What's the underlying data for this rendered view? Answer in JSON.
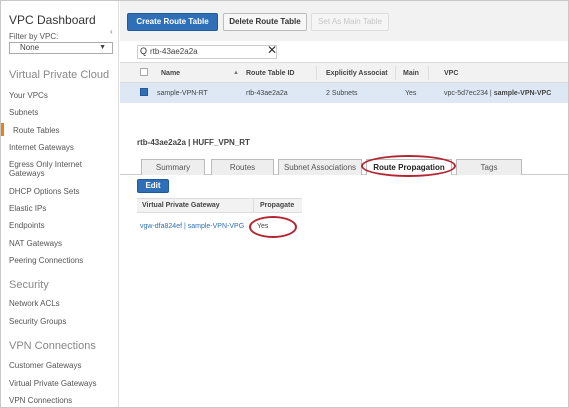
{
  "sidebar": {
    "title": "VPC Dashboard",
    "collapse_glyph": "‹",
    "filter_label": "Filter by VPC:",
    "filter_value": "None",
    "sections": {
      "vpc": "Virtual Private Cloud",
      "security": "Security",
      "vpn": "VPN Connections"
    },
    "vpc_items": [
      "Your VPCs",
      "Subnets",
      "Route Tables",
      "Internet Gateways",
      "Egress Only Internet",
      "Gateways",
      "DHCP Options Sets",
      "Elastic IPs",
      "Endpoints",
      "NAT Gateways",
      "Peering Connections"
    ],
    "security_items": [
      "Network ACLs",
      "Security Groups"
    ],
    "vpn_items": [
      "Customer Gateways",
      "Virtual Private Gateways",
      "VPN Connections"
    ]
  },
  "toolbar": {
    "create": "Create Route Table",
    "delete": "Delete Route Table",
    "set_main": "Set As Main Table"
  },
  "search": {
    "value": "rtb-43ae2a2a",
    "search_glyph": "Q",
    "clear_glyph": "✕"
  },
  "table": {
    "headers": {
      "name": "Name",
      "route_table_id": "Route Table ID",
      "explicit": "Explicitly Associat",
      "main": "Main",
      "vpc": "VPC"
    },
    "sort_glyph": "▲",
    "row": {
      "name": "sample-VPN-RT",
      "route_table_id": "rtb-43ae2a2a",
      "explicit": "2 Subnets",
      "main": "Yes",
      "vpc_id": "vpc-5d7ec234 |",
      "vpc_name": "sample-VPN-VPC"
    }
  },
  "detail": {
    "title": "rtb-43ae2a2a | HUFF_VPN_RT",
    "tabs": [
      "Summary",
      "Routes",
      "Subnet Associations",
      "Route Propagation",
      "Tags"
    ],
    "active_tab": "Route Propagation",
    "edit": "Edit",
    "headers": {
      "gateway": "Virtual Private Gateway",
      "propagate": "Propagate"
    },
    "row": {
      "gateway": "vgw-dfa824ef | sample-VPN-VPG",
      "propagate": "Yes"
    }
  },
  "colors": {
    "primary_blue": "#2f6fb8",
    "highlight_red": "#b32530",
    "active_orange": "#e6811c",
    "selected_row": "#dde8f4"
  }
}
